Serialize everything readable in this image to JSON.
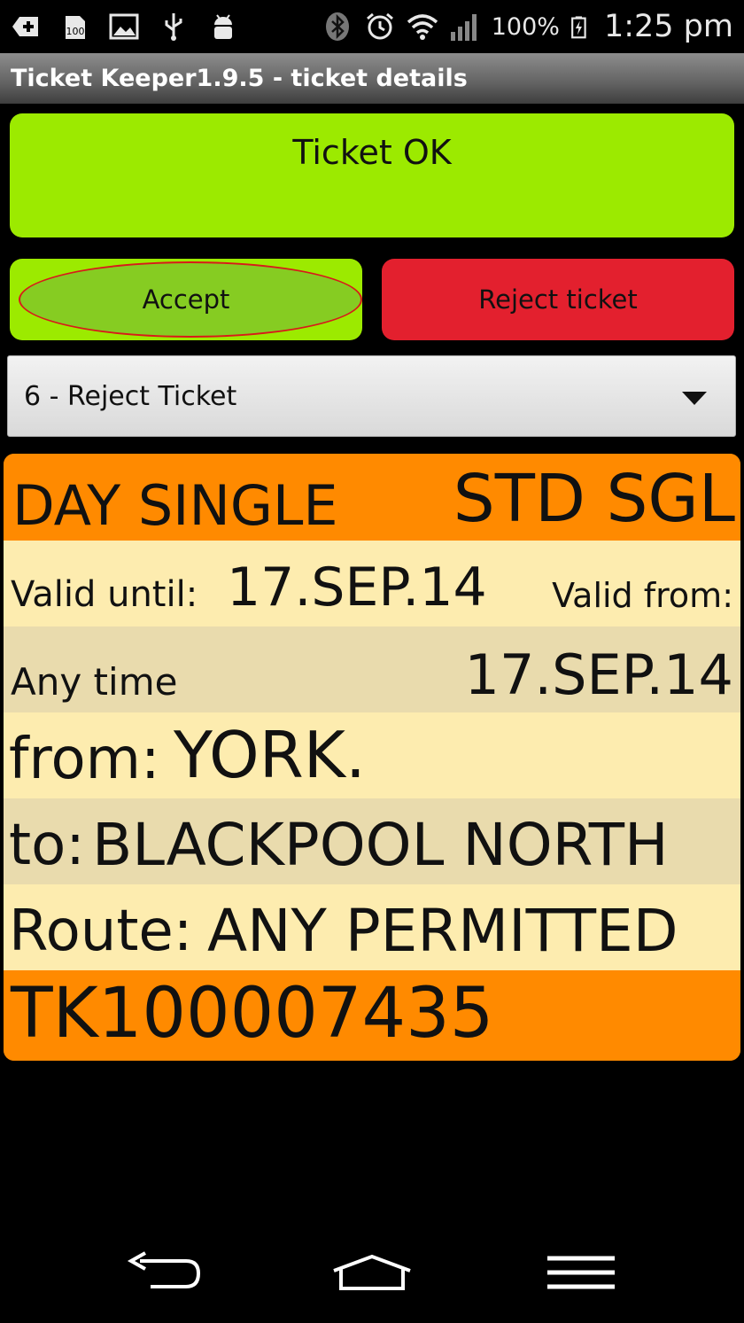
{
  "status_bar": {
    "battery_percent": "100%",
    "time": "1:25 pm",
    "notification_icon_label": "100",
    "icons": [
      "bluetooth-icon",
      "alarm-icon",
      "wifi-icon",
      "signal-icon",
      "battery-charging-icon"
    ]
  },
  "title_bar": {
    "title": "Ticket Keeper1.9.5 - ticket details"
  },
  "status_box": {
    "label": "Ticket OK",
    "color": "#9cea00"
  },
  "actions": {
    "accept_label": "Accept",
    "reject_label": "Reject ticket",
    "accept_color": "#9cea00",
    "reject_color": "#e3202e"
  },
  "reason_select": {
    "selected": "6 - Reject Ticket"
  },
  "ticket": {
    "type": "DAY SINGLE",
    "class": "STD SGL",
    "valid_until_label": "Valid until:",
    "valid_until": "17.SEP.14",
    "valid_from_label": "Valid from:",
    "time_restriction": "Any time",
    "valid_from": "17.SEP.14",
    "from_label": "from:",
    "from": "YORK.",
    "to_label": "to:",
    "to": "BLACKPOOL NORTH",
    "route_label": "Route:",
    "route": "ANY PERMITTED",
    "number": "TK100007435",
    "header_color": "#ff8a00",
    "body_color": "#fdecaf"
  },
  "nav_bar": {
    "buttons": [
      "back-icon",
      "home-icon",
      "menu-icon"
    ]
  }
}
